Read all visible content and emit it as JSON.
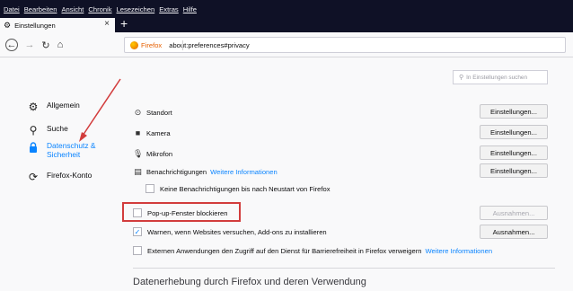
{
  "menubar": [
    "Datei",
    "Bearbeiten",
    "Ansicht",
    "Chronik",
    "Lesezeichen",
    "Extras",
    "Hilfe"
  ],
  "tab": {
    "title": "Einstellungen"
  },
  "urlbar": {
    "brand": "Firefox",
    "url": "about:preferences#privacy"
  },
  "search": {
    "placeholder": "In Einstellungen suchen"
  },
  "sidebar": [
    {
      "label": "Allgemein",
      "icon": "gear-icon"
    },
    {
      "label": "Suche",
      "icon": "search-icon"
    },
    {
      "label": "Datenschutz &",
      "label2": "Sicherheit",
      "icon": "lock-icon",
      "active": true
    },
    {
      "label": "Firefox-Konto",
      "icon": "sync-icon"
    }
  ],
  "permissions": [
    {
      "label": "Standort",
      "icon": "location-icon",
      "button": "Einstellungen..."
    },
    {
      "label": "Kamera",
      "icon": "camera-icon",
      "button": "Einstellungen..."
    },
    {
      "label": "Mikrofon",
      "icon": "microphone-icon",
      "button": "Einstellungen..."
    },
    {
      "label": "Benachrichtigungen",
      "link": "Weitere Informationen",
      "icon": "notification-icon",
      "button": "Einstellungen..."
    }
  ],
  "notify_pause": "Keine Benachrichtigungen bis nach Neustart von Firefox",
  "popup": {
    "label": "Pop-up-Fenster blockieren",
    "button": "Ausnahmen...",
    "checked": false
  },
  "addons": {
    "label": "Warnen, wenn Websites versuchen, Add-ons zu installieren",
    "button": "Ausnahmen...",
    "checked": true
  },
  "accessibility": {
    "label": "Externen Anwendungen den Zugriff auf den Dienst für Barrierefreiheit in Firefox verweigern",
    "link": "Weitere Informationen",
    "checked": false
  },
  "section_title": "Datenerhebung durch Firefox und deren Verwendung",
  "colors": {
    "accent": "#0a84ff",
    "highlight": "#d23c3c",
    "titlebar": "#0f1126"
  }
}
